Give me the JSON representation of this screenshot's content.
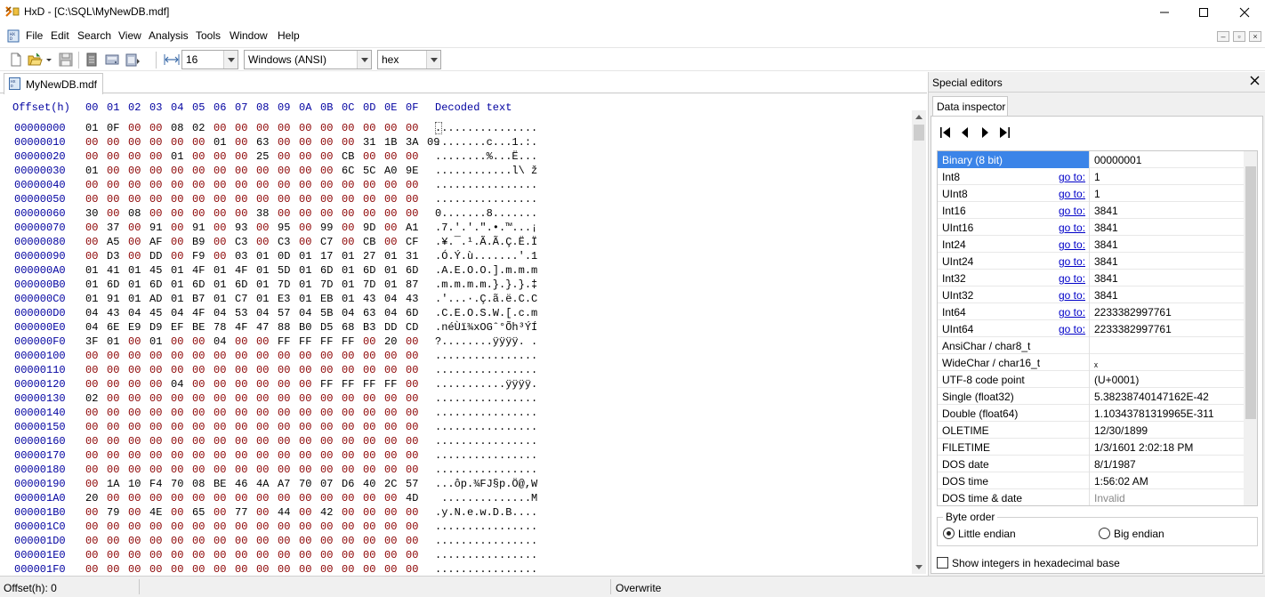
{
  "window": {
    "title": "HxD - [C:\\SQL\\MyNewDB.mdf]",
    "icons": [
      "hxd-app-icon",
      "minimize-icon",
      "maximize-icon",
      "close-icon"
    ]
  },
  "menu": [
    "File",
    "Edit",
    "Search",
    "View",
    "Analysis",
    "Tools",
    "Window",
    "Help"
  ],
  "toolbar": {
    "bytes_per_row": "16",
    "charset": "Windows (ANSI)",
    "display": "hex",
    "icons": [
      "new-file-icon",
      "open-file-icon",
      "dropdown-arrow-icon",
      "save-icon",
      "properties-icon",
      "open-disk-icon",
      "open-ram-icon",
      "bytes-per-row-icon"
    ]
  },
  "tab": {
    "label": "MyNewDB.mdf"
  },
  "hex": {
    "offset_header": "Offset(h)",
    "columns": [
      "00",
      "01",
      "02",
      "03",
      "04",
      "05",
      "06",
      "07",
      "08",
      "09",
      "0A",
      "0B",
      "0C",
      "0D",
      "0E",
      "0F"
    ],
    "decoded_header": "Decoded text",
    "rows": [
      {
        "offset": "00000000",
        "bytes": [
          "01",
          "0F",
          "00",
          "00",
          "08",
          "02",
          "00",
          "00",
          "00",
          "00",
          "00",
          "00",
          "00",
          "00",
          "00",
          "00"
        ],
        "text": "................"
      },
      {
        "offset": "00000010",
        "bytes": [
          "00",
          "00",
          "00",
          "00",
          "00",
          "00",
          "01",
          "00",
          "63",
          "00",
          "00",
          "00",
          "00",
          "31",
          "1B",
          "3A",
          "09"
        ],
        "text": "........c...1.:."
      },
      {
        "offset": "00000020",
        "bytes": [
          "00",
          "00",
          "00",
          "00",
          "01",
          "00",
          "00",
          "00",
          "25",
          "00",
          "00",
          "00",
          "CB",
          "00",
          "00",
          "00"
        ],
        "text": "........%...Ë..."
      },
      {
        "offset": "00000030",
        "bytes": [
          "01",
          "00",
          "00",
          "00",
          "00",
          "00",
          "00",
          "00",
          "00",
          "00",
          "00",
          "00",
          "6C",
          "5C",
          "A0",
          "9E"
        ],
        "text": "............l\\ ž"
      },
      {
        "offset": "00000040",
        "bytes": [
          "00",
          "00",
          "00",
          "00",
          "00",
          "00",
          "00",
          "00",
          "00",
          "00",
          "00",
          "00",
          "00",
          "00",
          "00",
          "00"
        ],
        "text": "................"
      },
      {
        "offset": "00000050",
        "bytes": [
          "00",
          "00",
          "00",
          "00",
          "00",
          "00",
          "00",
          "00",
          "00",
          "00",
          "00",
          "00",
          "00",
          "00",
          "00",
          "00"
        ],
        "text": "................"
      },
      {
        "offset": "00000060",
        "bytes": [
          "30",
          "00",
          "08",
          "00",
          "00",
          "00",
          "00",
          "00",
          "38",
          "00",
          "00",
          "00",
          "00",
          "00",
          "00",
          "00"
        ],
        "text": "0.......8......."
      },
      {
        "offset": "00000070",
        "bytes": [
          "00",
          "37",
          "00",
          "91",
          "00",
          "91",
          "00",
          "93",
          "00",
          "95",
          "00",
          "99",
          "00",
          "9D",
          "00",
          "A1"
        ],
        "text": ".7.'.'.\".•.™...¡"
      },
      {
        "offset": "00000080",
        "bytes": [
          "00",
          "A5",
          "00",
          "AF",
          "00",
          "B9",
          "00",
          "C3",
          "00",
          "C3",
          "00",
          "C7",
          "00",
          "CB",
          "00",
          "CF"
        ],
        "text": ".¥.¯.¹.Ã.Ã.Ç.Ë.Ï"
      },
      {
        "offset": "00000090",
        "bytes": [
          "00",
          "D3",
          "00",
          "DD",
          "00",
          "F9",
          "00",
          "03",
          "01",
          "0D",
          "01",
          "17",
          "01",
          "27",
          "01",
          "31"
        ],
        "text": ".Ó.Ý.ù.......'.1"
      },
      {
        "offset": "000000A0",
        "bytes": [
          "01",
          "41",
          "01",
          "45",
          "01",
          "4F",
          "01",
          "4F",
          "01",
          "5D",
          "01",
          "6D",
          "01",
          "6D",
          "01",
          "6D"
        ],
        "text": ".A.E.O.O.].m.m.m"
      },
      {
        "offset": "000000B0",
        "bytes": [
          "01",
          "6D",
          "01",
          "6D",
          "01",
          "6D",
          "01",
          "6D",
          "01",
          "7D",
          "01",
          "7D",
          "01",
          "7D",
          "01",
          "87"
        ],
        "text": ".m.m.m.m.}.}.}.‡"
      },
      {
        "offset": "000000C0",
        "bytes": [
          "01",
          "91",
          "01",
          "AD",
          "01",
          "B7",
          "01",
          "C7",
          "01",
          "E3",
          "01",
          "EB",
          "01",
          "43",
          "04",
          "43"
        ],
        "text": ".'...·.Ç.ã.ë.C.C"
      },
      {
        "offset": "000000D0",
        "bytes": [
          "04",
          "43",
          "04",
          "45",
          "04",
          "4F",
          "04",
          "53",
          "04",
          "57",
          "04",
          "5B",
          "04",
          "63",
          "04",
          "6D"
        ],
        "text": ".C.E.O.S.W.[.c.m"
      },
      {
        "offset": "000000E0",
        "bytes": [
          "04",
          "6E",
          "E9",
          "D9",
          "EF",
          "BE",
          "78",
          "4F",
          "47",
          "88",
          "B0",
          "D5",
          "68",
          "B3",
          "DD",
          "CD"
        ],
        "text": ".néÙï¾xOGˆ°Õh³ÝÍ"
      },
      {
        "offset": "000000F0",
        "bytes": [
          "3F",
          "01",
          "00",
          "01",
          "00",
          "00",
          "04",
          "00",
          "00",
          "FF",
          "FF",
          "FF",
          "FF",
          "00",
          "20",
          "00"
        ],
        "text": "?........ÿÿÿÿ. ."
      },
      {
        "offset": "00000100",
        "bytes": [
          "00",
          "00",
          "00",
          "00",
          "00",
          "00",
          "00",
          "00",
          "00",
          "00",
          "00",
          "00",
          "00",
          "00",
          "00",
          "00"
        ],
        "text": "................"
      },
      {
        "offset": "00000110",
        "bytes": [
          "00",
          "00",
          "00",
          "00",
          "00",
          "00",
          "00",
          "00",
          "00",
          "00",
          "00",
          "00",
          "00",
          "00",
          "00",
          "00"
        ],
        "text": "................"
      },
      {
        "offset": "00000120",
        "bytes": [
          "00",
          "00",
          "00",
          "00",
          "04",
          "00",
          "00",
          "00",
          "00",
          "00",
          "00",
          "FF",
          "FF",
          "FF",
          "FF",
          "00"
        ],
        "text": "...........ÿÿÿÿ."
      },
      {
        "offset": "00000130",
        "bytes": [
          "02",
          "00",
          "00",
          "00",
          "00",
          "00",
          "00",
          "00",
          "00",
          "00",
          "00",
          "00",
          "00",
          "00",
          "00",
          "00"
        ],
        "text": "................"
      },
      {
        "offset": "00000140",
        "bytes": [
          "00",
          "00",
          "00",
          "00",
          "00",
          "00",
          "00",
          "00",
          "00",
          "00",
          "00",
          "00",
          "00",
          "00",
          "00",
          "00"
        ],
        "text": "................"
      },
      {
        "offset": "00000150",
        "bytes": [
          "00",
          "00",
          "00",
          "00",
          "00",
          "00",
          "00",
          "00",
          "00",
          "00",
          "00",
          "00",
          "00",
          "00",
          "00",
          "00"
        ],
        "text": "................"
      },
      {
        "offset": "00000160",
        "bytes": [
          "00",
          "00",
          "00",
          "00",
          "00",
          "00",
          "00",
          "00",
          "00",
          "00",
          "00",
          "00",
          "00",
          "00",
          "00",
          "00"
        ],
        "text": "................"
      },
      {
        "offset": "00000170",
        "bytes": [
          "00",
          "00",
          "00",
          "00",
          "00",
          "00",
          "00",
          "00",
          "00",
          "00",
          "00",
          "00",
          "00",
          "00",
          "00",
          "00"
        ],
        "text": "................"
      },
      {
        "offset": "00000180",
        "bytes": [
          "00",
          "00",
          "00",
          "00",
          "00",
          "00",
          "00",
          "00",
          "00",
          "00",
          "00",
          "00",
          "00",
          "00",
          "00",
          "00"
        ],
        "text": "................"
      },
      {
        "offset": "00000190",
        "bytes": [
          "00",
          "1A",
          "10",
          "F4",
          "70",
          "08",
          "BE",
          "46",
          "4A",
          "A7",
          "70",
          "07",
          "D6",
          "40",
          "2C",
          "57"
        ],
        "text": "...ôp.¾FJ§p.Ö@,W"
      },
      {
        "offset": "000001A0",
        "bytes": [
          "20",
          "00",
          "00",
          "00",
          "00",
          "00",
          "00",
          "00",
          "00",
          "00",
          "00",
          "00",
          "00",
          "00",
          "00",
          "4D"
        ],
        "text": " ..............M"
      },
      {
        "offset": "000001B0",
        "bytes": [
          "00",
          "79",
          "00",
          "4E",
          "00",
          "65",
          "00",
          "77",
          "00",
          "44",
          "00",
          "42",
          "00",
          "00",
          "00",
          "00"
        ],
        "text": ".y.N.e.w.D.B...."
      },
      {
        "offset": "000001C0",
        "bytes": [
          "00",
          "00",
          "00",
          "00",
          "00",
          "00",
          "00",
          "00",
          "00",
          "00",
          "00",
          "00",
          "00",
          "00",
          "00",
          "00"
        ],
        "text": "................"
      },
      {
        "offset": "000001D0",
        "bytes": [
          "00",
          "00",
          "00",
          "00",
          "00",
          "00",
          "00",
          "00",
          "00",
          "00",
          "00",
          "00",
          "00",
          "00",
          "00",
          "00"
        ],
        "text": "................"
      },
      {
        "offset": "000001E0",
        "bytes": [
          "00",
          "00",
          "00",
          "00",
          "00",
          "00",
          "00",
          "00",
          "00",
          "00",
          "00",
          "00",
          "00",
          "00",
          "00",
          "00"
        ],
        "text": "................"
      },
      {
        "offset": "000001F0",
        "bytes": [
          "00",
          "00",
          "00",
          "00",
          "00",
          "00",
          "00",
          "00",
          "00",
          "00",
          "00",
          "00",
          "00",
          "00",
          "00",
          "00"
        ],
        "text": "................"
      }
    ]
  },
  "special_editors": {
    "title": "Special editors",
    "tab": "Data inspector",
    "nav_icons": [
      "first-icon",
      "prev-icon",
      "next-icon",
      "last-icon"
    ],
    "rows": [
      {
        "label": "Binary (8 bit)",
        "goto": "",
        "value": "00000001",
        "selected": true
      },
      {
        "label": "Int8",
        "goto": "go to:",
        "value": "1"
      },
      {
        "label": "UInt8",
        "goto": "go to:",
        "value": "1"
      },
      {
        "label": "Int16",
        "goto": "go to:",
        "value": "3841"
      },
      {
        "label": "UInt16",
        "goto": "go to:",
        "value": "3841"
      },
      {
        "label": "Int24",
        "goto": "go to:",
        "value": "3841"
      },
      {
        "label": "UInt24",
        "goto": "go to:",
        "value": "3841"
      },
      {
        "label": "Int32",
        "goto": "go to:",
        "value": "3841"
      },
      {
        "label": "UInt32",
        "goto": "go to:",
        "value": "3841"
      },
      {
        "label": "Int64",
        "goto": "go to:",
        "value": "2233382997761"
      },
      {
        "label": "UInt64",
        "goto": "go to:",
        "value": "2233382997761"
      },
      {
        "label": "AnsiChar / char8_t",
        "goto": "",
        "value": ""
      },
      {
        "label": "WideChar / char16_t",
        "goto": "",
        "value": "ₓ"
      },
      {
        "label": "UTF-8 code point",
        "goto": "",
        "value": "    (U+0001)"
      },
      {
        "label": "Single (float32)",
        "goto": "",
        "value": "5.38238740147162E-42"
      },
      {
        "label": "Double (float64)",
        "goto": "",
        "value": "1.10343781319965E-311"
      },
      {
        "label": "OLETIME",
        "goto": "",
        "value": "12/30/1899"
      },
      {
        "label": "FILETIME",
        "goto": "",
        "value": "1/3/1601 2:02:18 PM"
      },
      {
        "label": "DOS date",
        "goto": "",
        "value": "8/1/1987"
      },
      {
        "label": "DOS time",
        "goto": "",
        "value": "1:56:02 AM"
      },
      {
        "label": "DOS time & date",
        "goto": "",
        "value": "Invalid",
        "muted": true
      }
    ],
    "byte_order": {
      "legend": "Byte order",
      "little": "Little endian",
      "big": "Big endian",
      "selected": "little"
    },
    "hex_checkbox": "Show integers in hexadecimal base"
  },
  "status": {
    "offset": "Offset(h): 0",
    "mode": "Overwrite"
  }
}
